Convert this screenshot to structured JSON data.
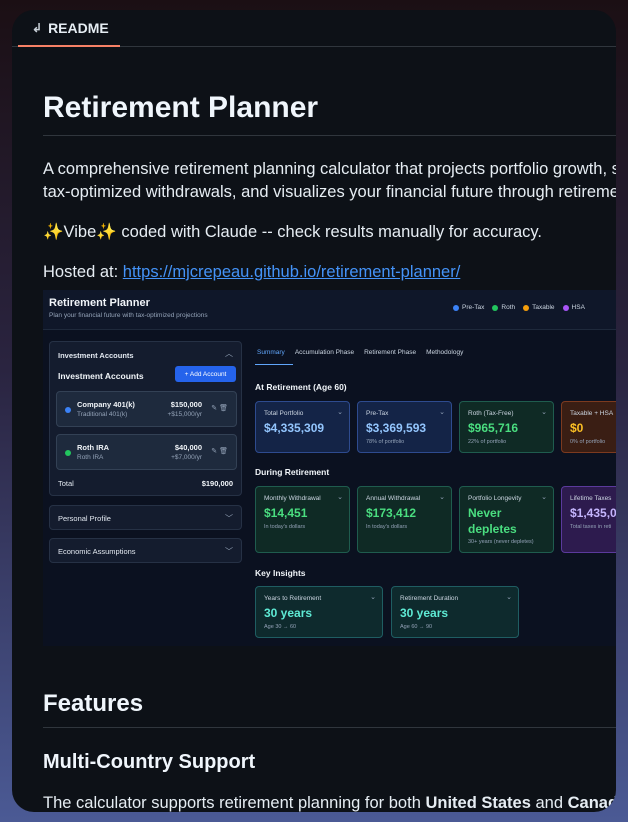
{
  "tab": {
    "icon": "list-icon",
    "label": "README"
  },
  "readme": {
    "title": "Retirement Planner",
    "intro_line1": "A comprehensive retirement planning calculator that projects portfolio growth, sim",
    "intro_line2": "tax-optimized withdrawals, and visualizes your financial future through retirement",
    "vibe": "✨Vibe✨ coded with Claude -- check results manually for accuracy.",
    "hosted_prefix": "Hosted at: ",
    "hosted_url": "https://mjcrepeau.github.io/retirement-planner/",
    "features_heading": "Features",
    "multi_country_heading": "Multi-Country Support",
    "multi_country_text_a": "The calculator supports retirement planning for both ",
    "multi_country_bold_a": "United States",
    "multi_country_text_b": " and ",
    "multi_country_bold_b": "Canada"
  },
  "screenshot": {
    "app_title": "Retirement Planner",
    "app_subtitle": "Plan your financial future with tax-optimized projections",
    "legend": [
      {
        "label": "Pre-Tax",
        "color": "#3b82f6"
      },
      {
        "label": "Roth",
        "color": "#22c55e"
      },
      {
        "label": "Taxable",
        "color": "#f59e0b"
      },
      {
        "label": "HSA",
        "color": "#a855f7"
      }
    ],
    "sidebar": {
      "section_title": "Investment Accounts",
      "list_title": "Investment Accounts",
      "add_button": "+ Add Account",
      "accounts": [
        {
          "name": "Company 401(k)",
          "type": "Traditional 401(k)",
          "amount": "$150,000",
          "contribution": "+$15,000/yr",
          "color": "#3b82f6"
        },
        {
          "name": "Roth IRA",
          "type": "Roth IRA",
          "amount": "$40,000",
          "contribution": "+$7,000/yr",
          "color": "#22c55e"
        }
      ],
      "total_label": "Total",
      "total_value": "$190,000",
      "personal_profile": "Personal Profile",
      "economic_assumptions": "Economic Assumptions"
    },
    "tabs": [
      "Summary",
      "Accumulation Phase",
      "Retirement Phase",
      "Methodology"
    ],
    "at_retirement_heading": "At Retirement (Age 60)",
    "at_retirement_cards": [
      {
        "label": "Total Portfolio",
        "value": "$4,335,309",
        "sub": ""
      },
      {
        "label": "Pre-Tax",
        "value": "$3,369,593",
        "sub": "78% of portfolio"
      },
      {
        "label": "Roth (Tax-Free)",
        "value": "$965,716",
        "sub": "22% of portfolio"
      },
      {
        "label": "Taxable + HSA",
        "value": "$0",
        "sub": "0% of portfolio"
      }
    ],
    "during_heading": "During Retirement",
    "during_cards": [
      {
        "label": "Monthly Withdrawal",
        "value": "$14,451",
        "sub": "In today's dollars"
      },
      {
        "label": "Annual Withdrawal",
        "value": "$173,412",
        "sub": "In today's dollars"
      },
      {
        "label": "Portfolio Longevity",
        "value_line1": "Never",
        "value_line2": "depletes",
        "sub": "30+ years (never depletes)"
      },
      {
        "label": "Lifetime Taxes",
        "value": "$1,435,0",
        "sub": "Total taxes in reti"
      }
    ],
    "insights_heading": "Key Insights",
    "insight_cards": [
      {
        "label": "Years to Retirement",
        "value": "30 years",
        "sub": "Age 30 → 60"
      },
      {
        "label": "Retirement Duration",
        "value": "30 years",
        "sub": "Age 60 → 90"
      }
    ]
  }
}
